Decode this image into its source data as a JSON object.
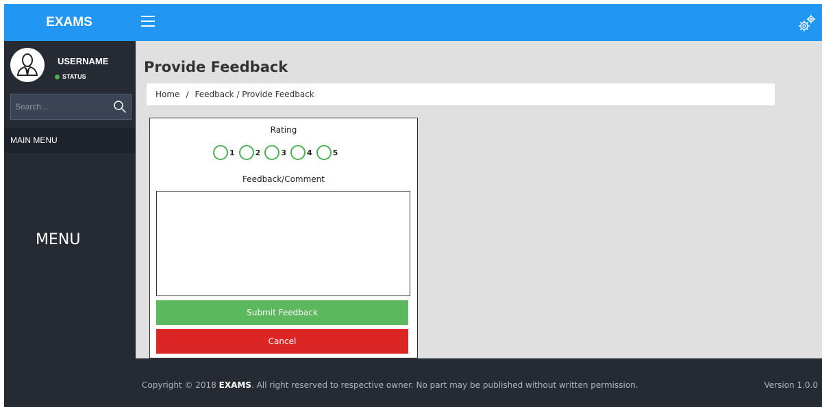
{
  "app": {
    "brand": "EXAMS"
  },
  "header": {
    "menu_icon": "hamburger-icon",
    "settings_icon": "gears-icon"
  },
  "sidebar": {
    "user": {
      "name": "USERNAME",
      "status": "STATUS",
      "status_color": "#4caf50"
    },
    "search": {
      "placeholder": "Search..."
    },
    "main_menu_label": "MAIN MENU",
    "menu_placeholder": "MENU"
  },
  "page": {
    "title": "Provide Feedback",
    "breadcrumb": {
      "home": "Home",
      "separator": "/",
      "rest": "Feedback / Provide Feedback"
    }
  },
  "form": {
    "rating_label": "Rating",
    "rating_options": [
      "1",
      "2",
      "3",
      "4",
      "5"
    ],
    "comment_label": "Feedback/Comment",
    "comment_value": "",
    "submit_label": "Submit Feedback",
    "cancel_label": "Cancel"
  },
  "footer": {
    "copyright_prefix": "Copyright © 2018 ",
    "copyright_brand": "EXAMS",
    "copyright_suffix": ". All right reserved to respective owner. No part may be published without written permission.",
    "version": "Version 1.0.0"
  },
  "colors": {
    "topbar": "#2196f3",
    "sidebar": "#252a33",
    "submit": "#5cb85c",
    "cancel": "#dc2626",
    "radio": "#4caf50"
  }
}
